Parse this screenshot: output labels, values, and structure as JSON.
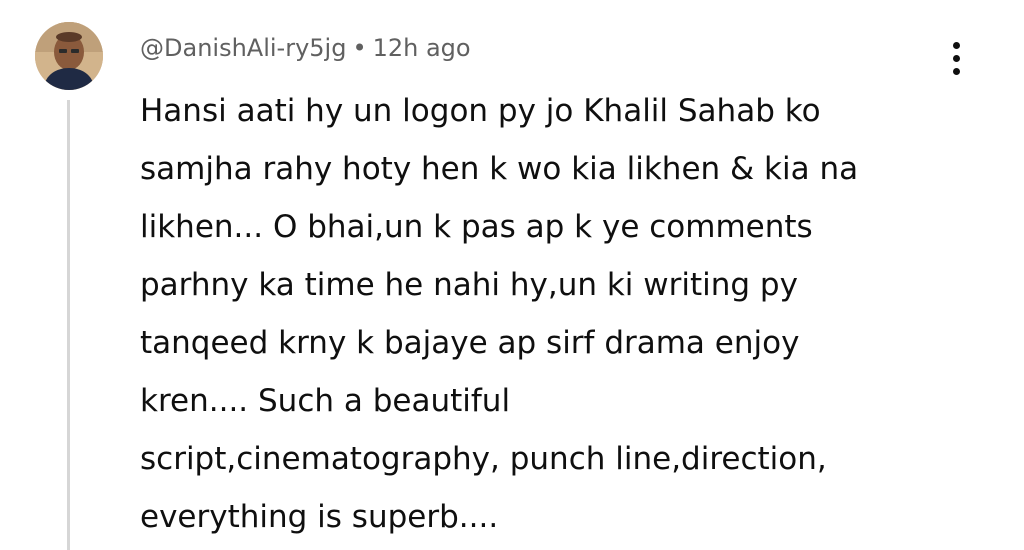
{
  "comment": {
    "author": "@DanishAli-ry5jg",
    "separator": "•",
    "time": "12h ago",
    "text_lines": [
      "Hansi aati hy un logon py jo Khalil Sahab ko",
      "samjha rahy hoty hen k wo kia likhen & kia na",
      "likhen... O bhai,un k pas ap k ye comments",
      "parhny ka time he nahi hy,un ki writing py",
      "tanqeed krny k bajaye ap sirf drama enjoy",
      "kren.... Such a beautiful",
      "script,cinematography, punch line,direction,",
      "everything is superb...."
    ],
    "menu_icon": "more-vertical-icon"
  }
}
